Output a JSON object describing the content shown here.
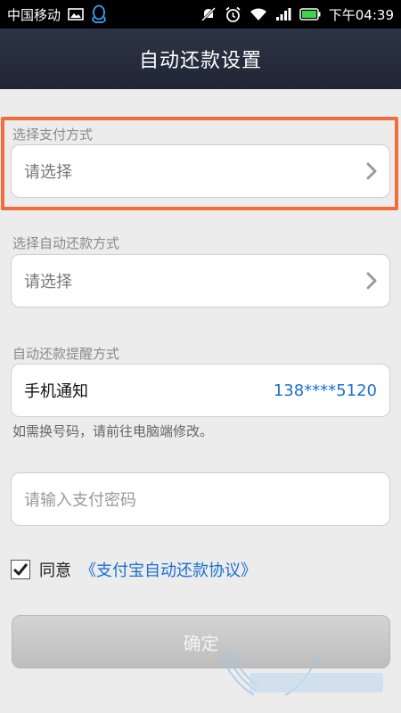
{
  "status_bar": {
    "carrier": "中国移动",
    "time": "下午04:39"
  },
  "header": {
    "title": "自动还款设置"
  },
  "payment_method": {
    "label": "选择支付方式",
    "value": "请选择"
  },
  "repay_method": {
    "label": "选择自动还款方式",
    "value": "请选择"
  },
  "reminder": {
    "label": "自动还款提醒方式",
    "method": "手机通知",
    "phone": "138****5120",
    "hint": "如需换号码，请前往电脑端修改。"
  },
  "password": {
    "placeholder": "请输入支付密码"
  },
  "agreement": {
    "checked": true,
    "prefix": "同意",
    "link": "《支付宝自动还款协议》"
  },
  "confirm": {
    "label": "确定"
  },
  "colors": {
    "highlight": "#f26d3d",
    "link": "#1a6fd1",
    "header_bg": "#262d3c"
  },
  "icons": [
    "image-icon",
    "qq-icon",
    "mute-icon",
    "alarm-icon",
    "wifi-icon",
    "signal-icon",
    "battery-icon",
    "chevron-right-icon",
    "checkmark-icon"
  ]
}
